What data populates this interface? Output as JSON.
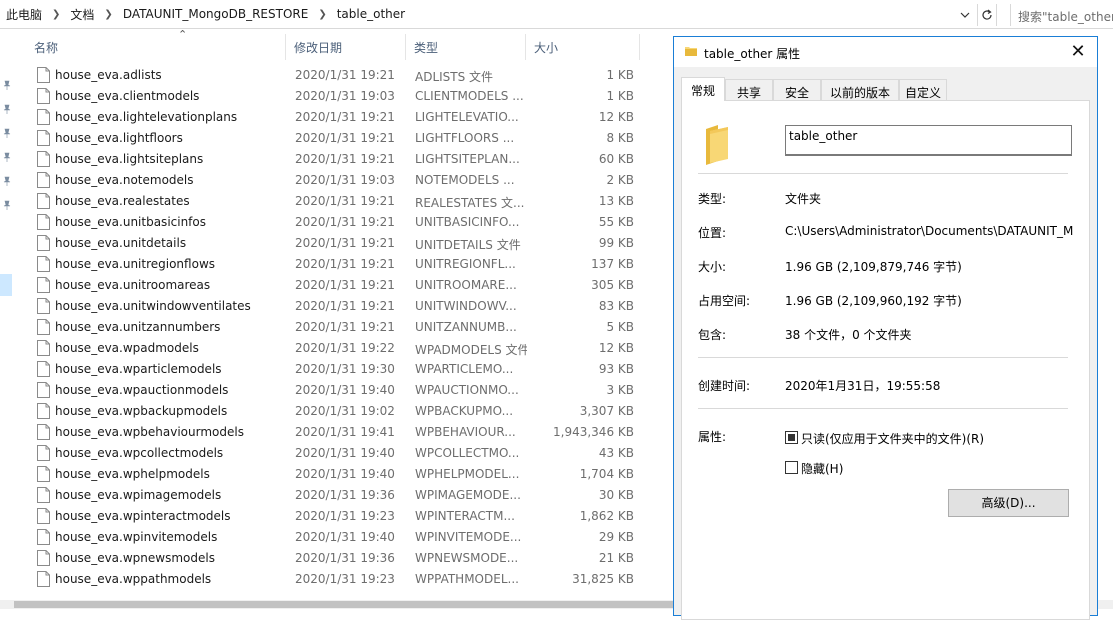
{
  "address_bar": {
    "crumbs": [
      "此电脑",
      "文档",
      "DATAUNIT_MongoDB_RESTORE",
      "table_other"
    ],
    "search_placeholder": "搜索\"table_other\""
  },
  "columns": {
    "name": "名称",
    "date": "修改日期",
    "type": "类型",
    "size": "大小"
  },
  "files": [
    {
      "name": "house_eva.adlists",
      "date": "2020/1/31 19:21",
      "type": "ADLISTS 文件",
      "size": "1 KB"
    },
    {
      "name": "house_eva.clientmodels",
      "date": "2020/1/31 19:03",
      "type": "CLIENTMODELS ...",
      "size": "1 KB"
    },
    {
      "name": "house_eva.lightelevationplans",
      "date": "2020/1/31 19:21",
      "type": "LIGHTELEVATIO...",
      "size": "12 KB"
    },
    {
      "name": "house_eva.lightfloors",
      "date": "2020/1/31 19:21",
      "type": "LIGHTFLOORS ...",
      "size": "8 KB"
    },
    {
      "name": "house_eva.lightsiteplans",
      "date": "2020/1/31 19:21",
      "type": "LIGHTSITEPLAN...",
      "size": "60 KB"
    },
    {
      "name": "house_eva.notemodels",
      "date": "2020/1/31 19:03",
      "type": "NOTEMODELS ...",
      "size": "2 KB"
    },
    {
      "name": "house_eva.realestates",
      "date": "2020/1/31 19:21",
      "type": "REALESTATES 文...",
      "size": "13 KB"
    },
    {
      "name": "house_eva.unitbasicinfos",
      "date": "2020/1/31 19:21",
      "type": "UNITBASICINFO...",
      "size": "55 KB"
    },
    {
      "name": "house_eva.unitdetails",
      "date": "2020/1/31 19:21",
      "type": "UNITDETAILS 文件",
      "size": "99 KB"
    },
    {
      "name": "house_eva.unitregionflows",
      "date": "2020/1/31 19:21",
      "type": "UNITREGIONFL...",
      "size": "137 KB"
    },
    {
      "name": "house_eva.unitroomareas",
      "date": "2020/1/31 19:21",
      "type": "UNITROOMARE...",
      "size": "305 KB"
    },
    {
      "name": "house_eva.unitwindowventilates",
      "date": "2020/1/31 19:21",
      "type": "UNITWINDOWV...",
      "size": "83 KB"
    },
    {
      "name": "house_eva.unitzannumbers",
      "date": "2020/1/31 19:21",
      "type": "UNITZANNUMB...",
      "size": "5 KB"
    },
    {
      "name": "house_eva.wpadmodels",
      "date": "2020/1/31 19:22",
      "type": "WPADMODELS 文件",
      "size": "12 KB"
    },
    {
      "name": "house_eva.wparticlemodels",
      "date": "2020/1/31 19:30",
      "type": "WPARTICLEMO...",
      "size": "93 KB"
    },
    {
      "name": "house_eva.wpauctionmodels",
      "date": "2020/1/31 19:40",
      "type": "WPAUCTIONMO...",
      "size": "3 KB"
    },
    {
      "name": "house_eva.wpbackupmodels",
      "date": "2020/1/31 19:02",
      "type": "WPBACKUPMO...",
      "size": "3,307 KB"
    },
    {
      "name": "house_eva.wpbehaviourmodels",
      "date": "2020/1/31 19:41",
      "type": "WPBEHAVIOUR...",
      "size": "1,943,346 KB"
    },
    {
      "name": "house_eva.wpcollectmodels",
      "date": "2020/1/31 19:40",
      "type": "WPCOLLECTMO...",
      "size": "43 KB"
    },
    {
      "name": "house_eva.wphelpmodels",
      "date": "2020/1/31 19:40",
      "type": "WPHELPMODEL...",
      "size": "1,704 KB"
    },
    {
      "name": "house_eva.wpimagemodels",
      "date": "2020/1/31 19:36",
      "type": "WPIMAGEMODE...",
      "size": "30 KB"
    },
    {
      "name": "house_eva.wpinteractmodels",
      "date": "2020/1/31 19:23",
      "type": "WPINTERACTM...",
      "size": "1,862 KB"
    },
    {
      "name": "house_eva.wpinvitemodels",
      "date": "2020/1/31 19:40",
      "type": "WPINVITEMODE...",
      "size": "29 KB"
    },
    {
      "name": "house_eva.wpnewsmodels",
      "date": "2020/1/31 19:36",
      "type": "WPNEWSMODE...",
      "size": "21 KB"
    },
    {
      "name": "house_eva.wppathmodels",
      "date": "2020/1/31 19:23",
      "type": "WPPATHMODEL...",
      "size": "31,825 KB"
    }
  ],
  "dialog": {
    "title": "table_other 属性",
    "tabs": [
      "常规",
      "共享",
      "安全",
      "以前的版本",
      "自定义"
    ],
    "active_tab": "常规",
    "folder_name": "table_other",
    "type_label": "类型:",
    "type_value": "文件夹",
    "location_label": "位置:",
    "location_value": "C:\\Users\\Administrator\\Documents\\DATAUNIT_M",
    "size_label": "大小:",
    "size_value": "1.96 GB (2,109,879,746 字节)",
    "disk_size_label": "占用空间:",
    "disk_size_value": "1.96 GB (2,109,960,192 字节)",
    "contains_label": "包含:",
    "contains_value": "38 个文件，0 个文件夹",
    "created_label": "创建时间:",
    "created_value": "2020年1月31日，19:55:58",
    "attributes_label": "属性:",
    "readonly_label": "只读(仅应用于文件夹中的文件)(R)",
    "readonly_state": "indeterminate",
    "hidden_label": "隐藏(H)",
    "hidden_state": false,
    "advanced_button": "高级(D)..."
  },
  "colors": {
    "folder_yellow": "#f8d775",
    "accent_blue": "#1a7ed6",
    "header_text": "#4c607a"
  }
}
